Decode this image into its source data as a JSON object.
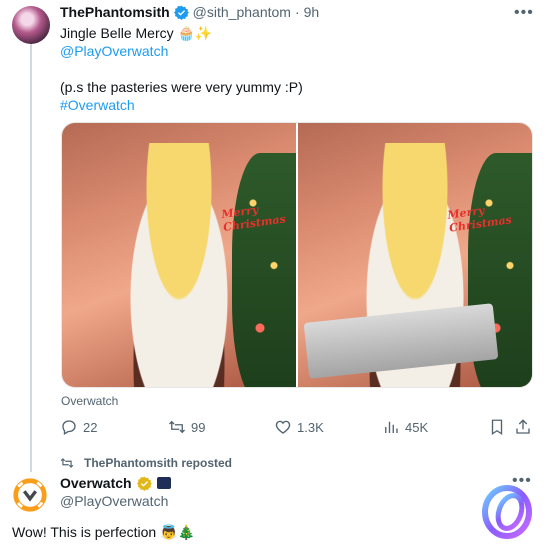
{
  "tweet": {
    "display_name": "ThePhantomsith",
    "handle": "@sith_phantom",
    "separator": "·",
    "time": "9h",
    "more": "•••",
    "line1": "Jingle Belle Mercy 🧁✨",
    "mention": "@PlayOverwatch",
    "line3": "(p.s the pasteries were very yummy :P)",
    "hashtag": "#Overwatch",
    "media_sign_left": "Merry Christmas",
    "media_sign_right": "Merry Christmas",
    "source_label": "Overwatch",
    "replies": "22",
    "reposts": "99",
    "likes": "1.3K",
    "views": "45K"
  },
  "repost_notice": {
    "text": "ThePhantomsith reposted"
  },
  "quoted": {
    "display_name": "Overwatch",
    "handle": "@PlayOverwatch",
    "more": "•••",
    "body": "Wow! This is perfection 👼🎄"
  },
  "colors": {
    "accent": "#1d9bf0",
    "muted": "#536471",
    "verified_gold": "#e2b719",
    "overwatch_orange": "#f99e1a"
  }
}
